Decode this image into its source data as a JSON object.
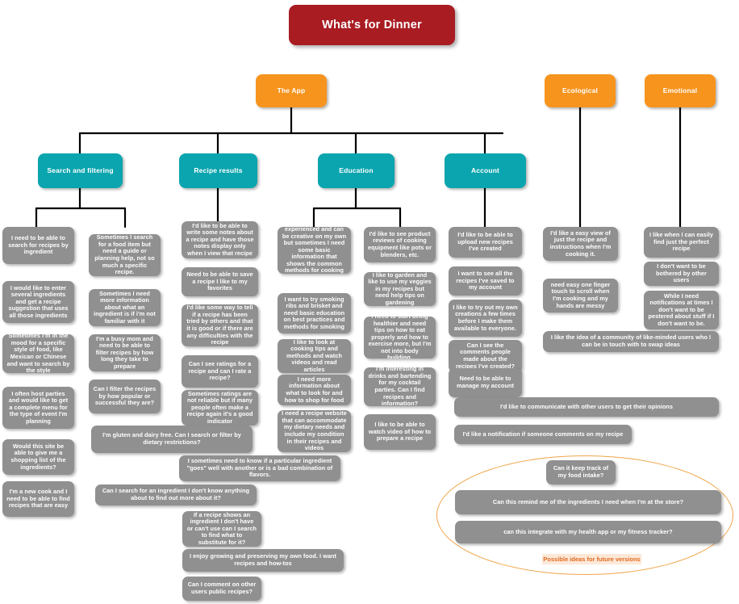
{
  "diagram": {
    "title": "What's for Dinner",
    "type": "affinity-diagram",
    "colors": {
      "root": "#a81c22",
      "category": "#f7941e",
      "subcategory": "#0aa5ae",
      "leaf": "#909090",
      "ellipse": "#f0a54a",
      "tag_background": "#fde8d8",
      "tag_text": "#e06a1f"
    },
    "root": {
      "label": "What's for Dinner"
    },
    "categories": [
      {
        "id": "app",
        "label": "The App"
      },
      {
        "id": "ecological",
        "label": "Ecological"
      },
      {
        "id": "emotional",
        "label": "Emotional"
      }
    ],
    "subcategories": [
      {
        "id": "search",
        "label": "Search and filtering"
      },
      {
        "id": "recipe",
        "label": "Recipe results"
      },
      {
        "id": "education",
        "label": "Education"
      },
      {
        "id": "account",
        "label": "Account"
      }
    ],
    "leaves": {
      "search_col1": [
        "I need to be able to search for recipes by ingredient",
        "I would like to enter several ingredients and get a recipe suggestion that uses all those ingredients",
        "Sometimes I'm in the mood for a specific style of food, like Mexican or Chinese and want to search by the style",
        "I often host parties and would like to get a complete menu for the type of event I'm planning",
        "Would this site be able to give me a shopping list of the ingredients?",
        "I'm a new cook and I need to be able to find recipes that are easy"
      ],
      "search_col2": [
        "Sometimes I search for a food item but need a guide or planning help, not so much a specific recipe.",
        "Sometimes I need more information about what an ingredient is if i'm not familiar with it",
        "I'm a busy mom and need to be able to filter recipes by how long they take to prepare",
        "Can I filter the recipes by how popular or successful they are?"
      ],
      "recipe_col": [
        "I'd like to be able to write some notes about a recipe and have those notes display only when I view that recipe",
        "Need to be able to save a recipe I like to my favorites",
        "I'd like some way to tell if a recipe has been tried by others and that it is good or if there are any difficulties with the recipe",
        "Can I see ratings for a recipe and can I rate a recipe?",
        "Sometimes ratings are not reliable but if many people often make a recipe again it's a good indicator"
      ],
      "education_col": [
        "I'm a little more experienced and can be creative on my own but sometimes I need some basic information that shows the common methods for cooking something",
        "I want to try smoking ribs and brisket and need basic education on best practices and methods for smoking",
        "I like to look at cooking tips and methods and watch videos and read articles",
        "I need more information about what to look for and how to shop for food",
        "I need a recipe website that can accommodate my dietary needs and include my condition in their recipes and videos"
      ],
      "education_col2": [
        "I'd like to see product reviews of cooking equipment like pots or blenders, etc.",
        "I like to garden and like to use my veggies in my recipes but need help tips on gardening",
        "I need to start being healthier and need tips on how to eat properly and how to exercise more, but I'm not into body building.",
        "I'm interesting in drinks and bartending for my cocktail parties. Can I find recipes and information?",
        "I like to be able to watch video of how to prepare a recipe"
      ],
      "account_col": [
        "I'd like to be able to upload new recipes I've created",
        "I want to see all the recipes I've saved to my account",
        "I like to try out my own creations a few times before I make them available to everyone.",
        "Can I see the comments people made about the recipes I've created?",
        "Need to be able to manage my account"
      ],
      "ecological_col": [
        "I'd like a easy view of just the recipe and instructions when I'm cooking it.",
        "need easy one finger touch to scroll when I'm cooking and my hands are messy"
      ],
      "emotional_col": [
        "I like when I can easily find just the perfect recipe",
        "I don't want to be bothered by other users",
        "While I need notifications at times I don't want to be pestered about stuff if I don't want to be."
      ],
      "wide": [
        "I like the idea of a community of like-minded users who I can be in touch with to swap ideas",
        "I'd like to communicate with other users to get their opinions",
        "I'd like a notification if someone comments on my recipe",
        "I'm gluten and dairy free. Can I search or filter by dietary restrictions?",
        "I sometimes need to know if a particular ingredient \"goes\" well with another or is a bad combination of flavors.",
        "Can I search for an ingredient I don't know anything about to find out more about it?",
        "If a recipe shows an ingredient I don't have or can't use can I search to find what to substitute for it?",
        "I enjoy growing and preserving my own food. I want recipes and how-tos",
        "Can I comment on other users public recipes?"
      ],
      "future": [
        "Can it keep track of my food intake?",
        "Can this remind me of the ingredients I need when I'm at the store?",
        "can this integrate with my health app or my fitness tracker?"
      ]
    },
    "annotation": {
      "label": "Possible ideas for future versions"
    }
  }
}
